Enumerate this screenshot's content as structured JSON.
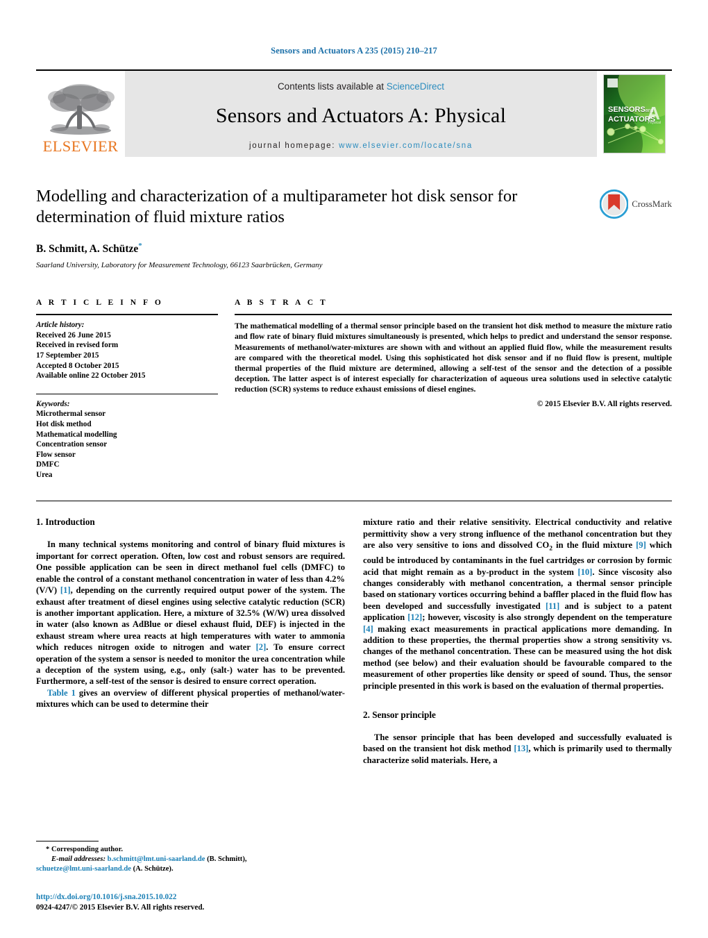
{
  "running_head": "Sensors and Actuators A 235 (2015) 210–217",
  "masthead": {
    "publisher_logo_label": "ELSEVIER",
    "contents_prefix": "Contents lists available at ",
    "contents_link": "ScienceDirect",
    "journal_title": "Sensors and Actuators A: Physical",
    "homepage_prefix": "journal homepage: ",
    "homepage_url": "www.elsevier.com/locate/sna",
    "cover": {
      "line1": "SENSORS",
      "line1_small": "and",
      "line2": "ACTUATORS",
      "letter": "A",
      "sub": "Physical"
    }
  },
  "article": {
    "title": "Modelling and characterization of a multiparameter hot disk sensor for determination of fluid mixture ratios",
    "authors": "B. Schmitt, A. Schütze",
    "corresponding_marker": "*",
    "affiliation": "Saarland University, Laboratory for Measurement Technology, 66123 Saarbrücken, Germany",
    "crossmark_label": "CrossMark"
  },
  "article_info": {
    "heading": "A R T I C L E   I N F O",
    "history_label": "Article history:",
    "history": [
      "Received 26 June 2015",
      "Received in revised form",
      "17 September 2015",
      "Accepted 8 October 2015",
      "Available online 22 October 2015"
    ],
    "keywords_label": "Keywords:",
    "keywords": [
      "Microthermal sensor",
      "Hot disk method",
      "Mathematical modelling",
      "Concentration sensor",
      "Flow sensor",
      "DMFC",
      "Urea"
    ]
  },
  "abstract": {
    "heading": "A B S T R A C T",
    "text": "The mathematical modelling of a thermal sensor principle based on the transient hot disk method to measure the mixture ratio and flow rate of binary fluid mixtures simultaneously is presented, which helps to predict and understand the sensor response. Measurements of methanol/water-mixtures are shown with and without an applied fluid flow, while the measurement results are compared with the theoretical model. Using this sophisticated hot disk sensor and if no fluid flow is present, multiple thermal properties of the fluid mixture are determined, allowing a self-test of the sensor and the detection of a possible deception. The latter aspect is of interest especially for characterization of aqueous urea solutions used in selective catalytic reduction (SCR) systems to reduce exhaust emissions of diesel engines.",
    "copyright": "© 2015 Elsevier B.V. All rights reserved."
  },
  "sections": {
    "intro_heading": "1. Introduction",
    "intro_p1_a": "In many technical systems monitoring and control of binary fluid mixtures is important for correct operation. Often, low cost and robust sensors are required. One possible application can be seen in direct methanol fuel cells (DMFC) to enable the control of a constant methanol concentration in water of less than 4.2% (V/V) ",
    "intro_p1_ref1": "[1]",
    "intro_p1_b": ", depending on the currently required output power of the system. The exhaust after treatment of diesel engines using selective catalytic reduction (SCR) is another important application. Here, a mixture of 32.5% (W/W) urea dissolved in water (also known as AdBlue or diesel exhaust fluid, DEF) is injected in the exhaust stream where urea reacts at high temperatures with water to ammonia which reduces nitrogen oxide to nitrogen and water ",
    "intro_p1_ref2": "[2]",
    "intro_p1_c": ". To ensure correct operation of the system a sensor is needed to monitor the urea concentration while a deception of the system using, e.g., only (salt-) water has to be prevented. Furthermore, a self-test of the sensor is desired to ensure correct operation.",
    "intro_p2_ref": "Table 1",
    "intro_p2_a": " gives an overview of different physical properties of methanol/water-mixtures which can be used to determine their",
    "right_p1_a": "mixture ratio and their relative sensitivity. Electrical conductivity and relative permittivity show a very strong influence of the methanol concentration but they are also very sensitive to ions and dissolved CO",
    "right_p1_sub": "2",
    "right_p1_b": " in the fluid mixture ",
    "right_p1_ref9": "[9]",
    "right_p1_c": " which could be introduced by contaminants in the fuel cartridges or corrosion by formic acid that might remain as a by-product in the system ",
    "right_p1_ref10": "[10]",
    "right_p1_d": ". Since viscosity also changes considerably with methanol concentration, a thermal sensor principle based on stationary vortices occurring behind a baffler placed in the fluid flow has been developed and successfully investigated ",
    "right_p1_ref11": "[11]",
    "right_p1_e": " and is subject to a patent application ",
    "right_p1_ref12": "[12]",
    "right_p1_f": "; however, viscosity is also strongly dependent on the temperature ",
    "right_p1_ref4": "[4]",
    "right_p1_g": " making exact measurements in practical applications more demanding. In addition to these properties, the thermal properties show a strong sensitivity vs. changes of the methanol concentration. These can be measured using the hot disk method (see below) and their evaluation should be favourable compared to the measurement of other properties like density or speed of sound. Thus, the sensor principle presented in this work is based on the evaluation of thermal properties.",
    "sensor_heading": "2. Sensor principle",
    "sensor_p1_a": "The sensor principle that has been developed and successfully evaluated is based on the transient hot disk method ",
    "sensor_p1_ref13": "[13]",
    "sensor_p1_b": ", which is primarily used to thermally characterize solid materials. Here, a"
  },
  "footnotes": {
    "corresponding": "* Corresponding author.",
    "email_label": "E-mail addresses:",
    "email1": "b.schmitt@lmt.uni-saarland.de",
    "email1_owner": " (B. Schmitt),",
    "email2": "schuetze@lmt.uni-saarland.de",
    "email2_owner": " (A. Schütze).",
    "doi": "http://dx.doi.org/10.1016/j.sna.2015.10.022",
    "issn_line": "0924-4247/© 2015 Elsevier B.V. All rights reserved."
  },
  "colors": {
    "link_blue": "#1a7fb5",
    "elsevier_orange": "#e87722",
    "band_gray": "#e6e6e6"
  }
}
